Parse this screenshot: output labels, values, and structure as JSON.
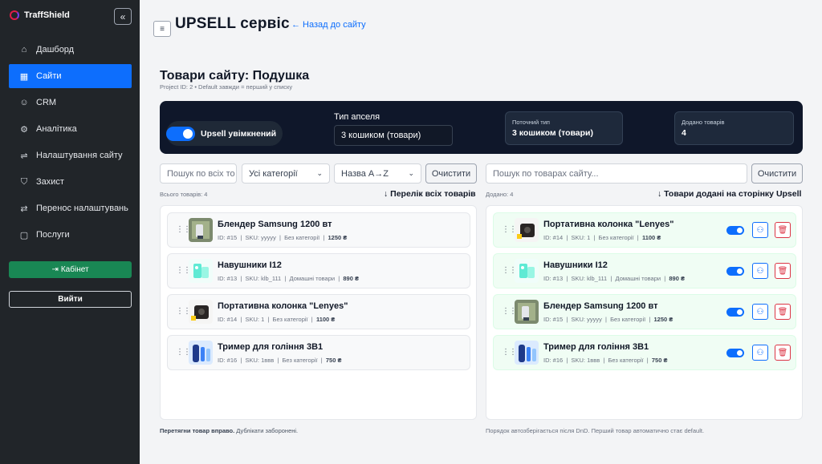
{
  "brand": {
    "name": "TraffShield"
  },
  "sidebar": {
    "items": [
      {
        "label": "Дашборд",
        "icon": "dashboard-icon",
        "glyph": "⌂"
      },
      {
        "label": "Сайти",
        "icon": "sites-icon",
        "glyph": "▦"
      },
      {
        "label": "CRM",
        "icon": "users-icon",
        "glyph": "☺"
      },
      {
        "label": "Аналітика",
        "icon": "analytics-gear-icon",
        "glyph": "⚙"
      },
      {
        "label": "Налаштування сайту",
        "icon": "settings-sliders-icon",
        "glyph": "⇌"
      },
      {
        "label": "Захист",
        "icon": "shield-icon",
        "glyph": "⛉"
      },
      {
        "label": "Перенос налаштувань",
        "icon": "transfer-icon",
        "glyph": "⇄"
      },
      {
        "label": "Послуги",
        "icon": "services-icon",
        "glyph": "▢"
      }
    ],
    "cabinet_label": "Кабінет",
    "logout_label": "Вийти"
  },
  "header": {
    "title": "UPSELL сервіс",
    "back_label": "← Назад до сайту"
  },
  "section": {
    "title": "Товари сайту: Подушка",
    "subtitle": "Project ID: 2 • Default завжди = перший у списку"
  },
  "panel": {
    "toggle_label": "Upsell увімкнений",
    "type_label": "Тип апселя",
    "type_value": "3 кошиком (товари)",
    "current_type_label": "Поточний тип",
    "current_type_value": "3 кошиком (товари)",
    "added_label": "Додано товарів",
    "added_value": "4"
  },
  "filters": {
    "search_all_placeholder": "Пошук по всіх то",
    "category_value": "Усі категорії",
    "sort_value": "Назва A→Z",
    "clear_label": "Очистити",
    "search_site_placeholder": "Пошук по товарах сайту...",
    "clear_right_label": "Очистити"
  },
  "left_column": {
    "count": "Всього товарів: 4",
    "title": "↓ Перелік всіх товарів",
    "items": [
      {
        "name": "Блендер Samsung 1200 вт",
        "id": "ID: #15",
        "sku": "SKU: yyyyy",
        "category": "Без категорії",
        "price": "1250 ₴"
      },
      {
        "name": "Навушники I12",
        "id": "ID: #13",
        "sku": "SKU: klb_111",
        "category": "Домашні товари",
        "price": "890 ₴"
      },
      {
        "name": "Портативна колонка \"Lenyes\"",
        "id": "ID: #14",
        "sku": "SKU: 1",
        "category": "Без категорії",
        "price": "1100 ₴"
      },
      {
        "name": "Тример для гоління 3В1",
        "id": "ID: #16",
        "sku": "SKU: 1ввв",
        "category": "Без категорії",
        "price": "750 ₴"
      }
    ],
    "footer_bold": "Перетягни товар вправо.",
    "footer_rest": " Дублікати заборонені."
  },
  "right_column": {
    "count": "Додано: 4",
    "title": "↓ Товари додані на сторінку Upsell",
    "items": [
      {
        "name": "Портативна колонка \"Lenyes\"",
        "id": "ID: #14",
        "sku": "SKU: 1",
        "category": "Без категорії",
        "price": "1100 ₴"
      },
      {
        "name": "Навушники I12",
        "id": "ID: #13",
        "sku": "SKU: klb_111",
        "category": "Домашні товари",
        "price": "890 ₴"
      },
      {
        "name": "Блендер Samsung 1200 вт",
        "id": "ID: #15",
        "sku": "SKU: yyyyy",
        "category": "Без категорії",
        "price": "1250 ₴"
      },
      {
        "name": "Тример для гоління 3В1",
        "id": "ID: #16",
        "sku": "SKU: 1ввв",
        "category": "Без категорії",
        "price": "750 ₴"
      }
    ],
    "footer": "Порядок автозберігається після DnD. Перший товар автоматично стає default."
  },
  "colors": {
    "accent": "#0d6efd",
    "sidebar_bg": "#212529",
    "panel_bg": "#0f172a",
    "success": "#198754",
    "danger": "#dc3545"
  }
}
